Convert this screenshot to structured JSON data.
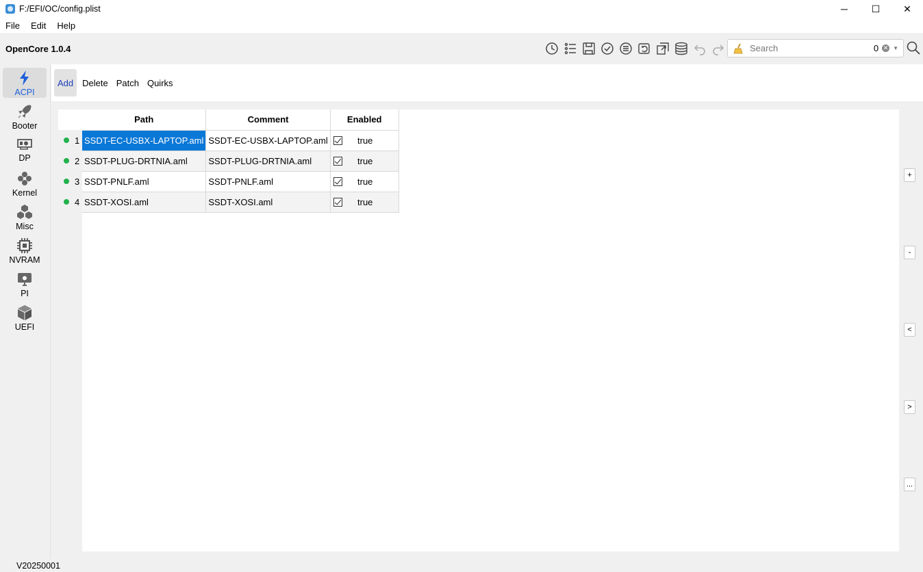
{
  "window": {
    "title": "F:/EFI/OC/config.plist",
    "minimize": "─",
    "maximize": "☐",
    "close": "✕"
  },
  "menu": [
    "File",
    "Edit",
    "Help"
  ],
  "toolbar": {
    "app_version": "OpenCore 1.0.4",
    "icons": [
      "history-icon",
      "list-icon",
      "save-icon",
      "check-icon",
      "list-check-icon",
      "sync-icon",
      "export-icon",
      "database-icon",
      "undo-icon",
      "redo-icon"
    ],
    "search": {
      "placeholder": "Search",
      "count": "0"
    }
  },
  "sidebar": {
    "items": [
      {
        "label": "ACPI",
        "icon": "lightning-icon",
        "active": true
      },
      {
        "label": "Booter",
        "icon": "rocket-icon"
      },
      {
        "label": "DP",
        "icon": "graphics-card-icon"
      },
      {
        "label": "Kernel",
        "icon": "kernel-icon"
      },
      {
        "label": "Misc",
        "icon": "cubes-icon"
      },
      {
        "label": "NVRAM",
        "icon": "chip-icon"
      },
      {
        "label": "PI",
        "icon": "apple-monitor-icon"
      },
      {
        "label": "UEFI",
        "icon": "box-icon"
      }
    ]
  },
  "tabs": [
    {
      "label": "Add",
      "active": true
    },
    {
      "label": "Delete"
    },
    {
      "label": "Patch"
    },
    {
      "label": "Quirks"
    }
  ],
  "table": {
    "columns": [
      "Path",
      "Comment",
      "Enabled"
    ],
    "rows": [
      {
        "num": "1",
        "path": "SSDT-EC-USBX-LAPTOP.aml",
        "comment": "SSDT-EC-USBX-LAPTOP.aml",
        "enabled": "true",
        "checked": true
      },
      {
        "num": "2",
        "path": "SSDT-PLUG-DRTNIA.aml",
        "comment": "SSDT-PLUG-DRTNIA.aml",
        "enabled": "true",
        "checked": true
      },
      {
        "num": "3",
        "path": "SSDT-PNLF.aml",
        "comment": "SSDT-PNLF.aml",
        "enabled": "true",
        "checked": true
      },
      {
        "num": "4",
        "path": "SSDT-XOSI.aml",
        "comment": "SSDT-XOSI.aml",
        "enabled": "true",
        "checked": true
      }
    ]
  },
  "side_buttons": {
    "add": "+",
    "remove": "-",
    "prev": "<",
    "next": ">",
    "more": "..."
  },
  "status": {
    "version": "V20250001"
  },
  "colors": {
    "accent": "#0a78d7",
    "status_dot": "#22b14c",
    "active_tab_text": "#1b3fb8"
  }
}
